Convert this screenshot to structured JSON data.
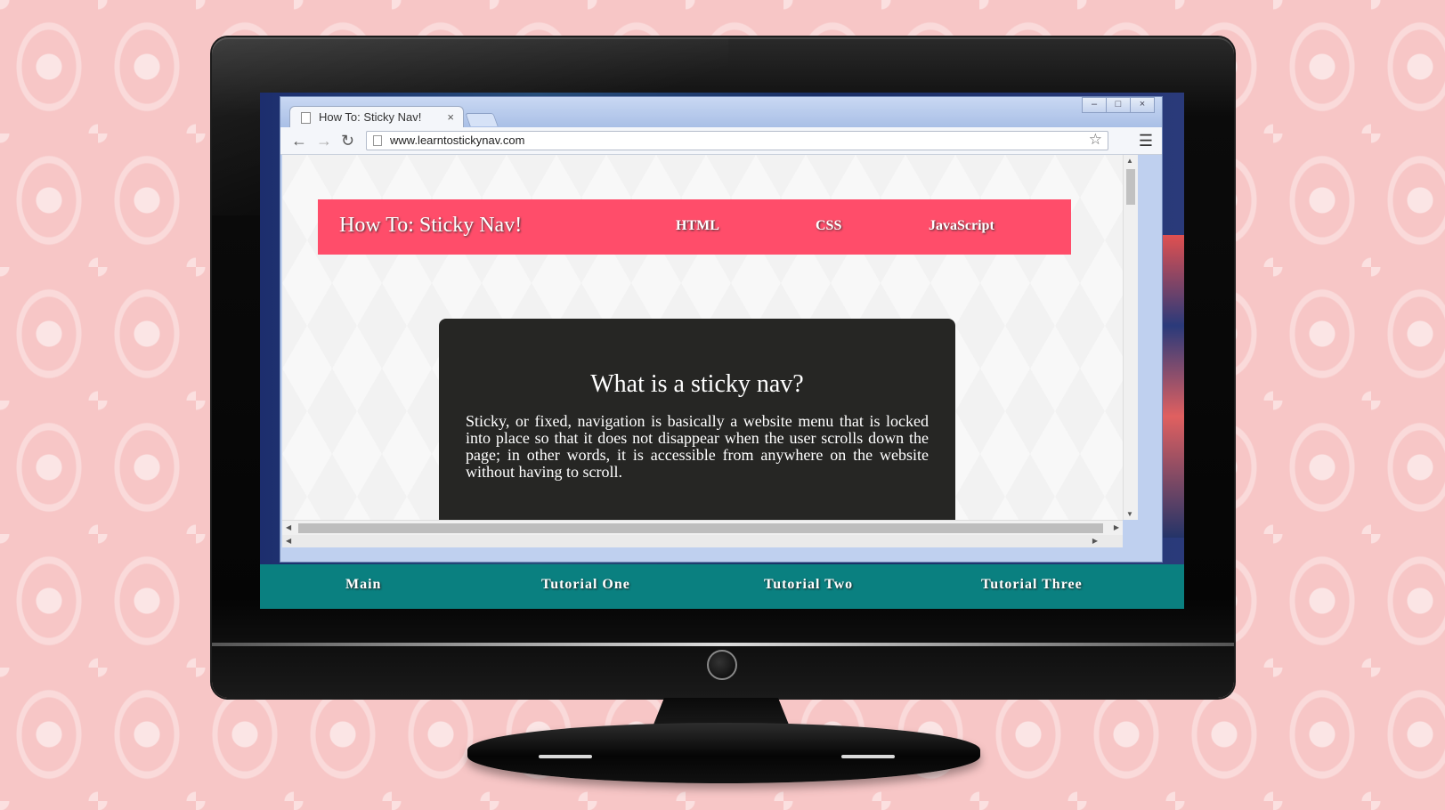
{
  "browser": {
    "tab_title": "How To: Sticky Nav!",
    "tab_close": "×",
    "url": "www.learntostickynav.com",
    "window_controls": [
      "minimize",
      "maximize",
      "close"
    ]
  },
  "site": {
    "title": "How To: Sticky Nav!",
    "nav": [
      "HTML",
      "CSS",
      "JavaScript"
    ]
  },
  "card": {
    "heading": "What is a sticky nav?",
    "body": "Sticky, or fixed, navigation is basically a website menu that is locked into place so that it does not disappear when the user scrolls down the page; in other words, it is accessible from anywhere on the website without having to scroll."
  },
  "footer_nav": [
    "Main",
    "Tutorial One",
    "Tutorial Two",
    "Tutorial Three"
  ],
  "colors": {
    "nav_bar": "#ff4d6a",
    "card": "#262624",
    "footer_bar": "#0a8080",
    "wallpaper": "#f7c6c6"
  }
}
